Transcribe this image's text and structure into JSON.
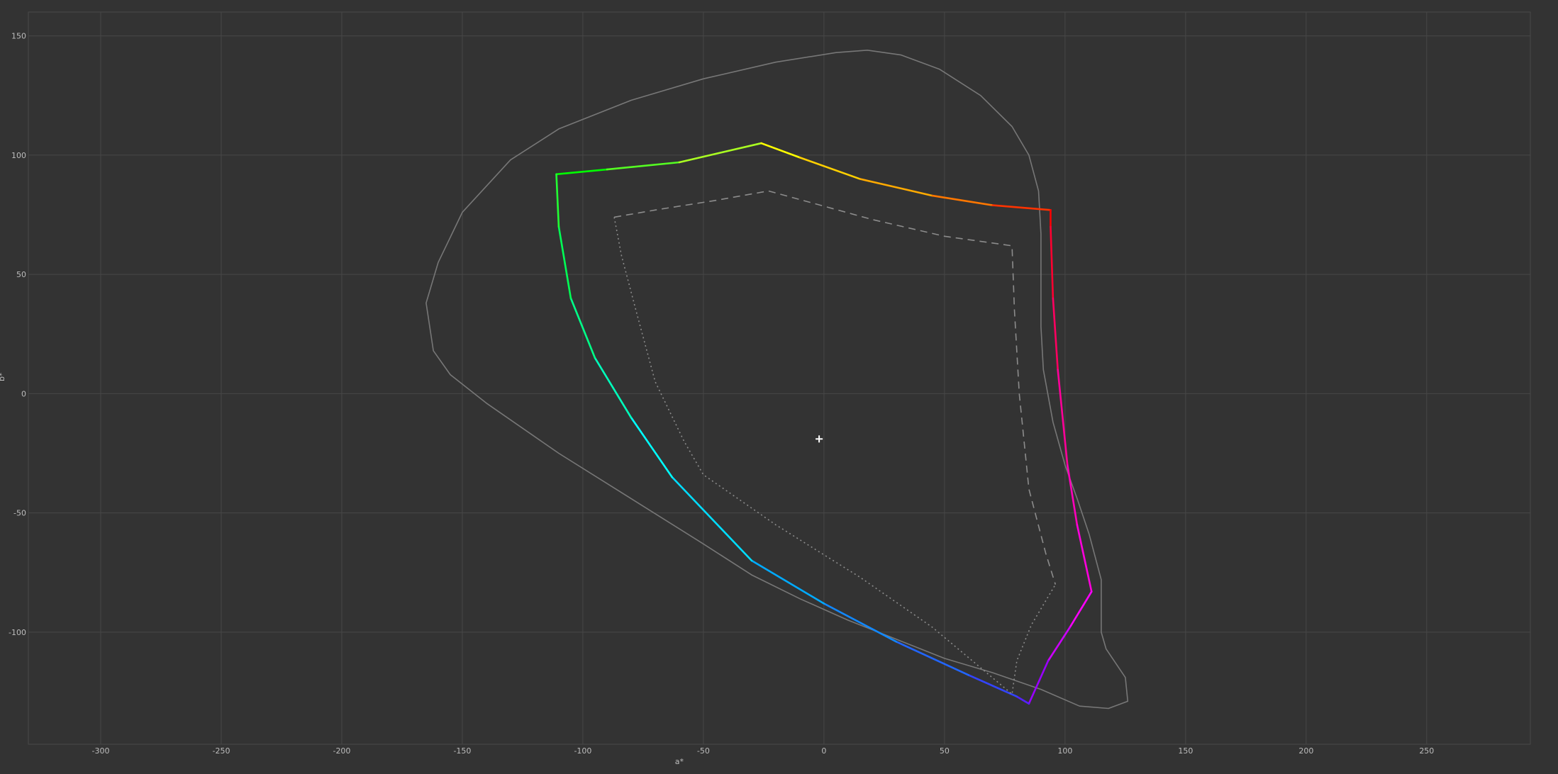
{
  "chart_data": {
    "type": "line",
    "title": "",
    "xlabel": "a*",
    "ylabel": "b*",
    "xlim": [
      -330,
      293
    ],
    "ylim": [
      -147,
      160
    ],
    "x_ticks": [
      -300,
      -250,
      -200,
      -150,
      -100,
      -50,
      0,
      50,
      100,
      150,
      200,
      250
    ],
    "y_ticks": [
      -100,
      -50,
      0,
      50,
      100,
      150
    ],
    "grid": true,
    "legend": "none",
    "colors": {
      "background": "#333333",
      "grid": "#474747",
      "outline": "#777777",
      "reference": "#8c8c8c",
      "marker": "#ffffff"
    },
    "series": [
      {
        "style": "solid-thin-gray",
        "points": [
          [
            18,
            144
          ],
          [
            5,
            143
          ],
          [
            -20,
            139
          ],
          [
            -50,
            132
          ],
          [
            -80,
            123
          ],
          [
            -110,
            111
          ],
          [
            -130,
            98
          ],
          [
            -150,
            76
          ],
          [
            -160,
            55
          ],
          [
            -165,
            38
          ],
          [
            -162,
            18
          ],
          [
            -155,
            8
          ],
          [
            -140,
            -4
          ],
          [
            -110,
            -25
          ],
          [
            -80,
            -44
          ],
          [
            -50,
            -63
          ],
          [
            -30,
            -76
          ],
          [
            -10,
            -86
          ],
          [
            10,
            -95
          ],
          [
            30,
            -103
          ],
          [
            50,
            -111
          ],
          [
            70,
            -117
          ],
          [
            90,
            -124
          ],
          [
            106,
            -131
          ],
          [
            118,
            -132
          ],
          [
            126,
            -129
          ],
          [
            125,
            -119
          ],
          [
            117,
            -107
          ],
          [
            115,
            -100
          ],
          [
            115,
            -90
          ],
          [
            115,
            -78
          ],
          [
            110,
            -59
          ],
          [
            105,
            -44
          ],
          [
            100,
            -30
          ],
          [
            95,
            -12
          ],
          [
            91,
            10
          ],
          [
            90,
            28
          ],
          [
            90,
            47
          ],
          [
            90,
            67
          ],
          [
            89,
            85
          ],
          [
            85,
            100
          ],
          [
            78,
            112
          ],
          [
            65,
            125
          ],
          [
            48,
            136
          ],
          [
            32,
            142
          ],
          [
            18,
            144
          ]
        ]
      },
      {
        "style": "rainbow-gamut",
        "points": [
          [
            -111,
            92
          ],
          [
            -90,
            94
          ],
          [
            -60,
            97
          ],
          [
            -26,
            105
          ],
          [
            -10,
            99
          ],
          [
            15,
            90
          ],
          [
            45,
            83
          ],
          [
            70,
            79
          ],
          [
            94,
            77
          ],
          [
            94,
            70
          ],
          [
            95,
            40
          ],
          [
            97,
            10
          ],
          [
            101,
            -30
          ],
          [
            105,
            -55
          ],
          [
            111,
            -83
          ],
          [
            102,
            -98
          ],
          [
            93,
            -112
          ],
          [
            85,
            -130
          ],
          [
            80,
            -127
          ],
          [
            60,
            -118
          ],
          [
            30,
            -104
          ],
          [
            0,
            -88
          ],
          [
            -30,
            -70
          ],
          [
            -63,
            -35
          ],
          [
            -80,
            -10
          ],
          [
            -95,
            15
          ],
          [
            -105,
            40
          ],
          [
            -110,
            70
          ],
          [
            -111,
            92
          ]
        ],
        "vertex_colors": [
          "#00ff00",
          "#55ff22",
          "#aaff22",
          "#ffff00",
          "#ffd000",
          "#ffaa00",
          "#ff7700",
          "#ff3300",
          "#ff0000",
          "#ff0030",
          "#ff0060",
          "#ff0099",
          "#ff00bb",
          "#ff00dd",
          "#ff00ff",
          "#cc00ff",
          "#9900ff",
          "#5522ff",
          "#3344ff",
          "#2266ff",
          "#1188ff",
          "#00aaff",
          "#00ddff",
          "#00ffff",
          "#00ffbb",
          "#00ff88",
          "#00ff55",
          "#22ff33",
          "#00ff00"
        ]
      },
      {
        "style": "dashed-gray",
        "points": [
          [
            -87,
            74
          ],
          [
            -70,
            77
          ],
          [
            -45,
            81
          ],
          [
            -23,
            85
          ],
          [
            -5,
            80
          ],
          [
            20,
            73
          ],
          [
            50,
            66
          ],
          [
            78,
            62
          ],
          [
            79,
            35
          ],
          [
            81,
            0
          ],
          [
            85,
            -40
          ],
          [
            92,
            -67
          ],
          [
            96,
            -80
          ]
        ]
      },
      {
        "style": "dotted-gray",
        "points": [
          [
            -87,
            74
          ],
          [
            -84,
            58
          ],
          [
            -78,
            35
          ],
          [
            -70,
            5
          ],
          [
            -58,
            -20
          ],
          [
            -50,
            -34
          ],
          [
            -20,
            -55
          ],
          [
            15,
            -77
          ],
          [
            45,
            -98
          ],
          [
            78,
            -126
          ],
          [
            80,
            -112
          ],
          [
            86,
            -97
          ],
          [
            96,
            -80
          ]
        ]
      }
    ],
    "marker": {
      "type": "cross",
      "x": -2,
      "y": -19
    }
  }
}
